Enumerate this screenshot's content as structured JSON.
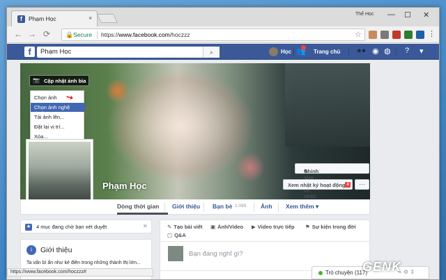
{
  "browser": {
    "tab_title": "Phạm Học",
    "tab_close": "×",
    "profile_user": "Thế Học",
    "window_buttons": {
      "minimize": "—",
      "maximize": "☐",
      "close": "✕"
    },
    "nav": {
      "back": "←",
      "forward": "→",
      "reload": "⟳"
    },
    "secure_label": "Secure",
    "url_scheme": "https://",
    "url_host": "www.facebook.com",
    "url_path": "/hoczzz",
    "star": "☆",
    "menu": "⋮",
    "status_url": "https://www.facebook.com/hoczzz#"
  },
  "fb_header": {
    "logo": "f",
    "search_value": "Phạm Học",
    "search_icon": "⌕",
    "user_name": "Học",
    "home_label": "Trang chủ"
  },
  "cover": {
    "update_cover_label": "Cập nhật ảnh bìa",
    "camera_icon": "📷",
    "menu_items": [
      "Chọn ảnh",
      "Chọn ảnh nghệ thuật",
      "Tải ảnh lên...",
      "Đặt lại vị trí...",
      "Xóa..."
    ],
    "active_item_index": 1
  },
  "profile": {
    "name": "Phạm Học",
    "edit_button": "Chỉnh sửa trang cá nhân",
    "edit_icon": "✎",
    "activity_button": "Xem nhật ký hoạt động",
    "activity_count": "4",
    "more_button": "···"
  },
  "profile_nav": {
    "items": [
      "Dòng thời gian",
      "Giới thiệu",
      "Bạn bè",
      "Ảnh",
      "Xem thêm"
    ],
    "friends_count": "1.095",
    "more_caret": "▾"
  },
  "left": {
    "review_text": "4 mục đang chờ bạn xét duyệt",
    "review_icon": "★",
    "review_close": "✕",
    "intro_title": "Giới thiệu",
    "intro_icon": "i",
    "intro_desc": "Ta vấn bí ẩn như kẻ điên trong những thành thị lớn..."
  },
  "composer": {
    "tabs": [
      "Tạo bài viết",
      "Ảnh/Video",
      "Video trực tiếp",
      "Sự kiện trong đời"
    ],
    "tab_icons": [
      "✎",
      "▣",
      "▶",
      "⚑"
    ],
    "qa_label": "Q&A",
    "placeholder": "Bạn đang nghĩ gì?"
  },
  "chat": {
    "label": "Trò chuyện (117)",
    "tools": "✎ ⚙ ⇕"
  },
  "watermark": "GENK"
}
